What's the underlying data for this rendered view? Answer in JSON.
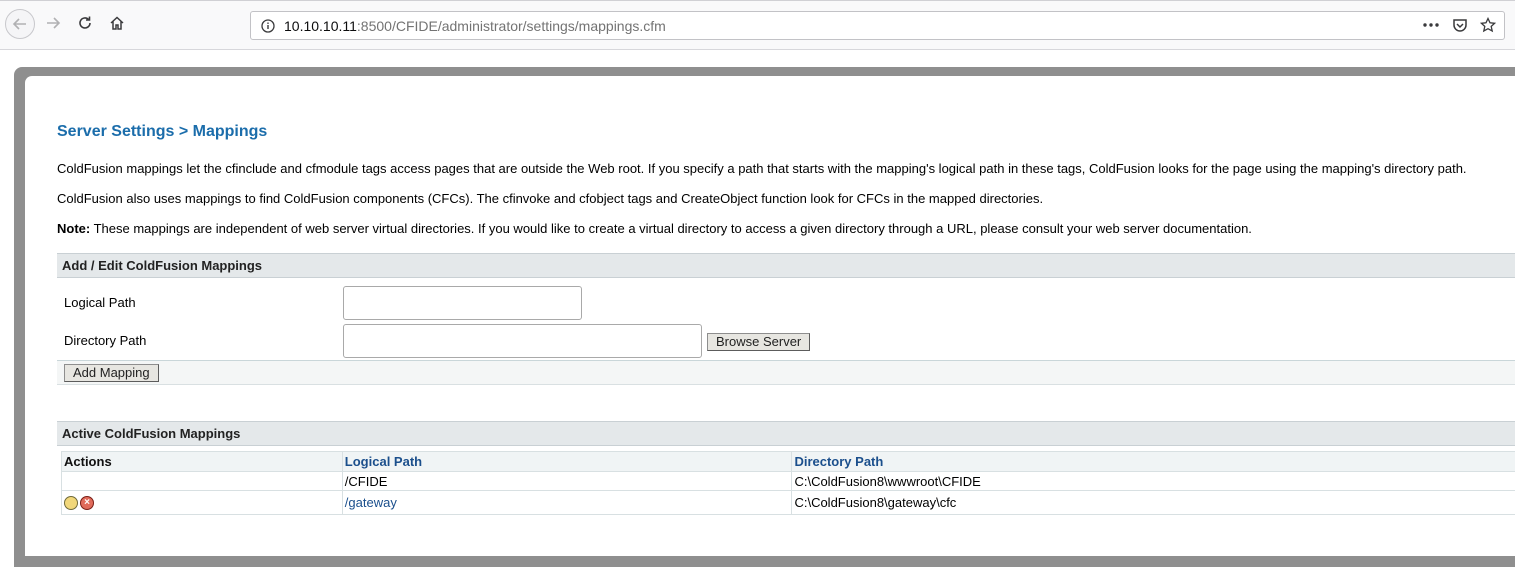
{
  "browser": {
    "url_host": "10.10.10.11",
    "url_rest": ":8500/CFIDE/administrator/settings/mappings.cfm"
  },
  "page": {
    "title": "Server Settings > Mappings",
    "para1": "ColdFusion mappings let the cfinclude and cfmodule tags access pages that are outside the Web root. If you specify a path that starts with the mapping's logical path in these tags, ColdFusion looks for the page using the mapping's directory path.",
    "para2": "ColdFusion also uses mappings to find ColdFusion components (CFCs). The cfinvoke and cfobject tags and CreateObject function look for CFCs in the mapped directories.",
    "note_label": "Note:",
    "note_text": " These mappings are independent of web server virtual directories. If you would like to create a virtual directory to access a given directory through a URL, please consult your web server documentation."
  },
  "add_section": {
    "heading": "Add / Edit ColdFusion Mappings",
    "logical_path_label": "Logical Path",
    "logical_path_value": "",
    "directory_path_label": "Directory Path",
    "directory_path_value": "",
    "browse_button": "Browse Server",
    "add_button": "Add Mapping"
  },
  "active_section": {
    "heading": "Active ColdFusion Mappings",
    "columns": {
      "actions": "Actions",
      "logical_path": "Logical Path",
      "directory_path": "Directory Path"
    },
    "rows": [
      {
        "logical_path": "/CFIDE",
        "directory_path": "C:\\ColdFusion8\\wwwroot\\CFIDE",
        "has_actions": false
      },
      {
        "logical_path": "/gateway",
        "directory_path": "C:\\ColdFusion8\\gateway\\cfc",
        "has_actions": true
      }
    ]
  },
  "colors": {
    "title": "#1b6dab",
    "link": "#1b4f8c",
    "section_bg": "#e4e8ea"
  }
}
